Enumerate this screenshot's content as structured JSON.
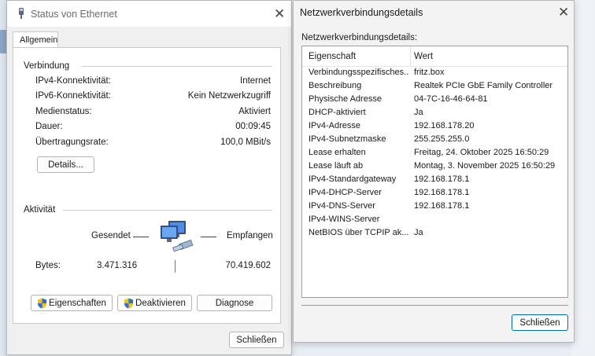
{
  "status_window": {
    "title": "Status von Ethernet",
    "tab": "Allgemein",
    "connection": {
      "group": "Verbindung",
      "rows": [
        {
          "label": "IPv4-Konnektivität:",
          "value": "Internet"
        },
        {
          "label": "IPv6-Konnektivität:",
          "value": "Kein Netzwerkzugriff"
        },
        {
          "label": "Medienstatus:",
          "value": "Aktiviert"
        },
        {
          "label": "Dauer:",
          "value": "00:09:45"
        },
        {
          "label": "Übertragungsrate:",
          "value": "100,0 MBit/s"
        }
      ],
      "details_button": "Details..."
    },
    "activity": {
      "group": "Aktivität",
      "sent_label": "Gesendet",
      "received_label": "Empfangen",
      "bytes_label": "Bytes:",
      "bytes_sent": "3.471.316",
      "bytes_received": "70.419.602"
    },
    "buttons": {
      "properties": "Eigenschaften",
      "disable": "Deaktivieren",
      "diagnose": "Diagnose",
      "close": "Schließen"
    }
  },
  "details_window": {
    "title": "Netzwerkverbindungsdetails",
    "label": "Netzwerkverbindungsdetails:",
    "columns": [
      "Eigenschaft",
      "Wert"
    ],
    "rows": [
      {
        "property": "Verbindungsspezifisches...",
        "value": "fritz.box"
      },
      {
        "property": "Beschreibung",
        "value": "Realtek PCIe GbE Family Controller"
      },
      {
        "property": "Physische Adresse",
        "value": "04-7C-16-46-64-81"
      },
      {
        "property": "DHCP-aktiviert",
        "value": "Ja"
      },
      {
        "property": "IPv4-Adresse",
        "value": "192.168.178.20"
      },
      {
        "property": "IPv4-Subnetzmaske",
        "value": "255.255.255.0"
      },
      {
        "property": "Lease erhalten",
        "value": "Freitag, 24. Oktober 2025 16:50:29"
      },
      {
        "property": "Lease läuft ab",
        "value": "Montag, 3. November 2025 16:50:29"
      },
      {
        "property": "IPv4-Standardgateway",
        "value": "192.168.178.1"
      },
      {
        "property": "IPv4-DHCP-Server",
        "value": "192.168.178.1"
      },
      {
        "property": "IPv4-DNS-Server",
        "value": "192.168.178.1"
      },
      {
        "property": "IPv4-WINS-Server",
        "value": ""
      },
      {
        "property": "NetBIOS über TCPIP ak...",
        "value": "Ja"
      }
    ],
    "close_button": "Schließen"
  },
  "icons": {
    "close": "close-icon",
    "network_adapter": "network-adapter-icon",
    "network_activity": "network-computers-icon",
    "uac_shield": "shield-icon"
  },
  "colors": {
    "accent": "#0067c0",
    "window_bg": "#f0f0f0",
    "panel_bg": "#ffffff"
  }
}
